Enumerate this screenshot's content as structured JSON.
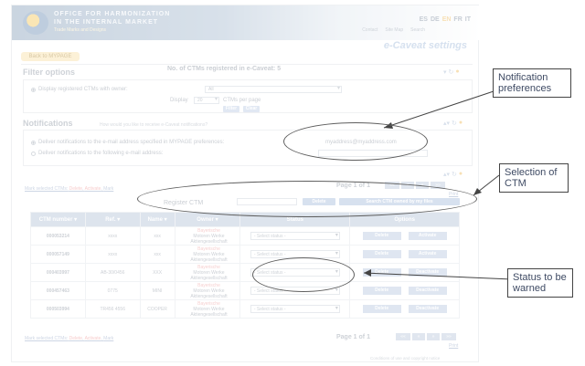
{
  "header": {
    "org_line1": "OFFICE FOR HARMONIZATION",
    "org_line2": "IN THE INTERNAL MARKET",
    "org_line3": "Trade Marks and Designs",
    "languages": [
      "ES",
      "DE",
      "EN",
      "FR",
      "IT"
    ],
    "active_language": "EN",
    "top_links": [
      "Contact",
      "Site Map",
      "Search"
    ]
  },
  "page_title": "e-Caveat settings",
  "back_button": "Back to MYPAGE",
  "filter": {
    "title": "Filter options",
    "registered_count": "No. of CTMs registered in e-Caveat: 5",
    "display_owner_label": "Display registered CTMs with owner:",
    "owner_value": "All",
    "display_label": "Display",
    "per_page_value": "20",
    "per_page_suffix": "CTMs per page",
    "filter_button": "Filter",
    "clear_button": "Clear"
  },
  "notifications": {
    "title": "Notifications",
    "subtitle": "How would you like to receive e-Caveat notifications?",
    "option1": "Deliver notifications to the e-mail address specified in MYPAGE preferences:",
    "option1_email": "myaddress@myaddress.com",
    "option2": "Deliver notifications to the following e-mail address:"
  },
  "register": {
    "label": "Register CTM",
    "delete_button": "Delete",
    "search_button": "Search CTM owned by my files"
  },
  "pagination": {
    "text": "Page 1 of 1",
    "print_link": "Print",
    "buttons": [
      "««",
      "«",
      "»",
      "»»"
    ]
  },
  "selection_links": {
    "prefix": "Mark selected CTMs:",
    "a": "Delete",
    "b": "Activate",
    "c": "Mark"
  },
  "table": {
    "headers": [
      "CTM number",
      "Ref.",
      "Name",
      "Owner",
      "Status",
      "Options"
    ],
    "select_placeholder": "- Select status -",
    "delete_label": "Delete",
    "rows": [
      {
        "ctm": "000053214",
        "ref": "xxxx",
        "name": "xxx",
        "owner": [
          "Bayerische",
          "Motoren Werke",
          "Aktiengesellschaft"
        ],
        "action2": "Activate"
      },
      {
        "ctm": "000057149",
        "ref": "xxxx",
        "name": "xxx",
        "owner": [
          "Bayerische",
          "Motoren Werke",
          "Aktiengesellschaft"
        ],
        "action2": "Activate"
      },
      {
        "ctm": "000403997",
        "ref": "AB-30/0456",
        "name": "XXX",
        "owner": [
          "Bayerische",
          "Motoren Werke",
          "Aktiengesellschaft"
        ],
        "action2": "Deactivate"
      },
      {
        "ctm": "000457463",
        "ref": "0775",
        "name": "MINI",
        "owner": [
          "Bayerische",
          "Motoren Werke",
          "Aktiengesellschaft"
        ],
        "action2": "Deactivate"
      },
      {
        "ctm": "000503994",
        "ref": "TR456 4556",
        "name": "COOPER",
        "owner": [
          "Bayerische",
          "Motoren Werke",
          "Aktiengesellschaft"
        ],
        "action2": "Deactivate"
      }
    ]
  },
  "footer": "Conditions of use and copyright notice",
  "callouts": {
    "notification": "Notification preferences",
    "selection": "Selection of CTM",
    "status": "Status to be warned"
  }
}
